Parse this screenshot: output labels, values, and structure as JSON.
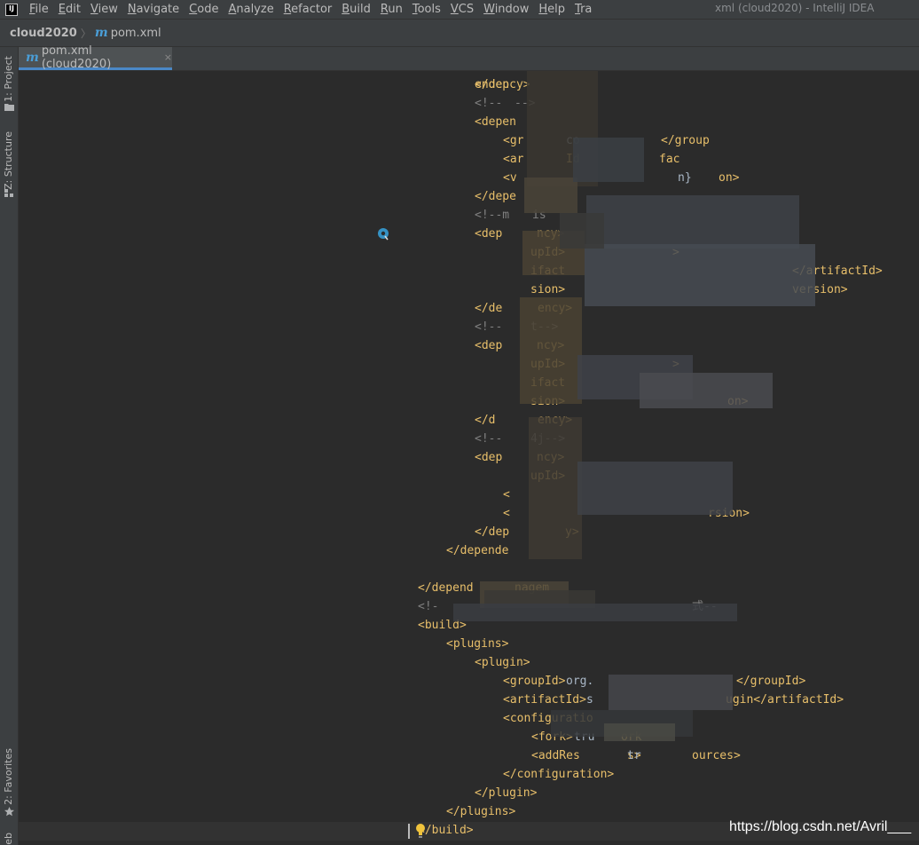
{
  "menubar": {
    "items": [
      "File",
      "Edit",
      "View",
      "Navigate",
      "Code",
      "Analyze",
      "Refactor",
      "Build",
      "Run",
      "Tools",
      "VCS",
      "Window",
      "Help",
      "Tra"
    ],
    "window_title": "xml (cloud2020) - IntelliJ IDEA"
  },
  "navbar": {
    "project": "cloud2020",
    "file": "pom.xml"
  },
  "tab": {
    "label": "pom.xml (cloud2020)",
    "close": "×"
  },
  "tool_windows": {
    "project": "1: Project",
    "structure": "Z: Structure",
    "favorites": "2: Favorites",
    "bottom": "eb"
  },
  "code_lines": [
    [
      {
        "t": "</dep",
        "c": "tag"
      },
      {
        "t": "endency>",
        "c": "tag"
      }
    ],
    [
      {
        "t": "<!--",
        "c": "cmt"
      },
      {
        "t": "-->",
        "c": "cmt"
      }
    ],
    [
      {
        "t": "<depen",
        "c": "tag"
      }
    ],
    [
      {
        "t": "<gr",
        "c": "tag"
      },
      {
        "t": "co",
        "c": "txt"
      },
      {
        "t": "</group",
        "c": "tag"
      }
    ],
    [
      {
        "t": "<ar",
        "c": "tag"
      },
      {
        "t": "Id",
        "c": "tag"
      },
      {
        "t": "fac",
        "c": "tag"
      }
    ],
    [
      {
        "t": "<v",
        "c": "tag"
      },
      {
        "t": "n}",
        "c": "txt"
      },
      {
        "t": "on>",
        "c": "tag"
      }
    ],
    [
      {
        "t": "</depe",
        "c": "tag"
      }
    ],
    [
      {
        "t": "<!--m",
        "c": "cmt"
      },
      {
        "t": "is",
        "c": "cmt"
      }
    ],
    [
      {
        "t": "<dep",
        "c": "tag"
      },
      {
        "t": "ncy>",
        "c": "tag"
      }
    ],
    [
      {
        "t": "upId>",
        "c": "tag"
      },
      {
        "t": ">",
        "c": "tag"
      }
    ],
    [
      {
        "t": "ifact",
        "c": "tag"
      },
      {
        "t": "</artifactId>",
        "c": "tag"
      }
    ],
    [
      {
        "t": "sion>",
        "c": "tag"
      },
      {
        "t": "version>",
        "c": "tag"
      }
    ],
    [
      {
        "t": "</de",
        "c": "tag"
      },
      {
        "t": "ency>",
        "c": "tag"
      }
    ],
    [
      {
        "t": "<!--",
        "c": "cmt"
      },
      {
        "t": "t-->",
        "c": "cmt"
      }
    ],
    [
      {
        "t": "<dep",
        "c": "tag"
      },
      {
        "t": "ncy>",
        "c": "tag"
      }
    ],
    [
      {
        "t": "upId>",
        "c": "tag"
      },
      {
        "t": ">",
        "c": "tag"
      }
    ],
    [
      {
        "t": "ifact",
        "c": "tag"
      }
    ],
    [
      {
        "t": "sion>",
        "c": "tag"
      },
      {
        "t": "on>",
        "c": "tag"
      }
    ],
    [
      {
        "t": "</d",
        "c": "tag"
      },
      {
        "t": "ency>",
        "c": "tag"
      }
    ],
    [
      {
        "t": "<!--",
        "c": "cmt"
      },
      {
        "t": "4j-->",
        "c": "cmt"
      }
    ],
    [
      {
        "t": "<dep",
        "c": "tag"
      },
      {
        "t": "ncy>",
        "c": "tag"
      }
    ],
    [
      {
        "t": "upId>",
        "c": "tag"
      }
    ],
    [
      {
        "t": "<",
        "c": "tag"
      }
    ],
    [
      {
        "t": "<",
        "c": "tag"
      },
      {
        "t": "rsion>",
        "c": "tag"
      }
    ],
    [
      {
        "t": "</dep",
        "c": "tag"
      },
      {
        "t": "y>",
        "c": "tag"
      }
    ],
    [
      {
        "t": "</depende",
        "c": "tag"
      }
    ],
    [],
    [
      {
        "t": "</depend",
        "c": "tag"
      },
      {
        "t": "nagem",
        "c": "tag"
      }
    ],
    [
      {
        "t": "<!-",
        "c": "cmt"
      },
      {
        "t": "式--",
        "c": "cmt"
      }
    ],
    [
      {
        "t": "<build>",
        "c": "tag"
      }
    ],
    [
      {
        "t": "<plugins>",
        "c": "tag"
      }
    ],
    [
      {
        "t": "<plugin>",
        "c": "tag"
      }
    ],
    [
      {
        "t": "<groupId>",
        "c": "tag"
      },
      {
        "t": "org.",
        "c": "txt"
      },
      {
        "t": "</groupId>",
        "c": "tag"
      }
    ],
    [
      {
        "t": "<artifactId>",
        "c": "tag"
      },
      {
        "t": "s",
        "c": "txt"
      },
      {
        "t": "ugin</artifactId>",
        "c": "tag"
      }
    ],
    [
      {
        "t": "<configuratio",
        "c": "tag"
      }
    ],
    [
      {
        "t": "<fork>",
        "c": "tag"
      },
      {
        "t": "tru",
        "c": "txt"
      },
      {
        "t": "ork",
        "c": "tag"
      }
    ],
    [
      {
        "t": "<addRes",
        "c": "tag"
      },
      {
        "t": "s>",
        "c": "tag"
      },
      {
        "t": "tr",
        "c": "txt"
      },
      {
        "t": "ources>",
        "c": "tag"
      }
    ],
    [
      {
        "t": "</configuration>",
        "c": "tag"
      }
    ],
    [
      {
        "t": "</plugin>",
        "c": "tag"
      }
    ],
    [
      {
        "t": "</plugins>",
        "c": "tag"
      }
    ],
    [
      {
        "t": "</build>",
        "c": "tag"
      }
    ]
  ],
  "watermark": "https://blog.csdn.net/Avril___",
  "colors": {
    "tag": "#e8bf6a",
    "text": "#a9b7c6",
    "comment": "#808080",
    "editor_bg": "#2b2b2b",
    "chrome_bg": "#3c3f41",
    "accent": "#4a88c7"
  }
}
